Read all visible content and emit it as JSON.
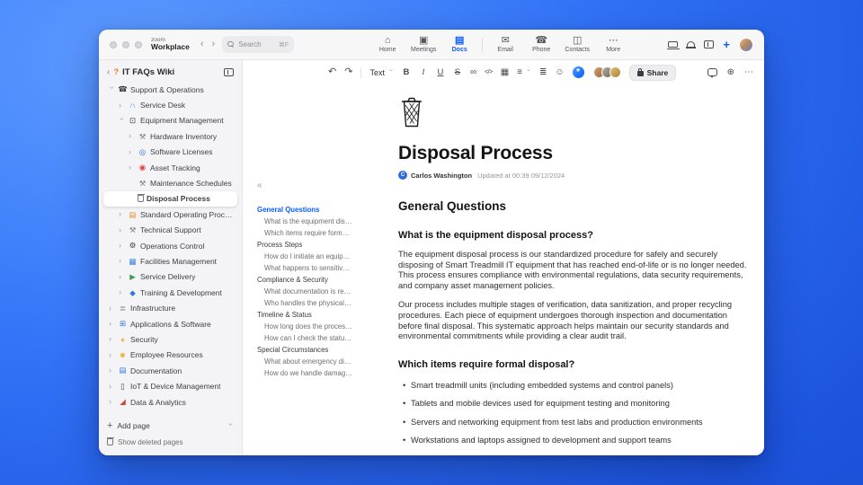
{
  "window": {
    "brand": {
      "top": "zoom",
      "bottom": "Workplace"
    },
    "search": {
      "placeholder": "Search",
      "shortcut": "⌘F"
    },
    "topnav": [
      {
        "label": "Home",
        "icon": "home-icon"
      },
      {
        "label": "Meetings",
        "icon": "meetings-icon"
      },
      {
        "label": "Docs",
        "icon": "docs-icon",
        "active": true
      },
      {
        "divider": true
      },
      {
        "label": "Email",
        "icon": "email-icon"
      },
      {
        "label": "Phone",
        "icon": "phone-icon"
      },
      {
        "label": "Contacts",
        "icon": "contacts-icon"
      },
      {
        "label": "More",
        "icon": "more-icon"
      }
    ],
    "right_icons": [
      "laptop-icon",
      "bell-icon",
      "panel-icon",
      "ai-companion-icon",
      "user-avatar"
    ]
  },
  "sidebar": {
    "emoji": "?",
    "title": "IT FAQs Wiki",
    "items": [
      {
        "label": "Support & Operations",
        "icon": "phone-icon",
        "color": "#3c3c41",
        "indent": 0,
        "chevron": "down"
      },
      {
        "label": "Service Desk",
        "icon": "headset-icon",
        "color": "#2f7bd9",
        "indent": 1,
        "chevron": "right"
      },
      {
        "label": "Equipment Management",
        "icon": "monitor-icon",
        "color": "#3c3c41",
        "indent": 1,
        "chevron": "down"
      },
      {
        "label": "Hardware Inventory",
        "icon": "wrench-icon",
        "color": "#7c7c82",
        "indent": 2,
        "chevron": "right"
      },
      {
        "label": "Software Licenses",
        "icon": "disc-icon",
        "color": "#2f7bd9",
        "indent": 2,
        "chevron": "right"
      },
      {
        "label": "Asset Tracking",
        "icon": "pin-icon",
        "color": "#d8433c",
        "indent": 2,
        "chevron": "right"
      },
      {
        "label": "Maintenance Schedules",
        "icon": "tools-icon",
        "color": "#7c7c82",
        "indent": 2,
        "chevron": null
      },
      {
        "label": "Disposal Process",
        "icon": "trash-icon",
        "color": "#5c5c61",
        "indent": 2,
        "chevron": null,
        "selected": true
      },
      {
        "label": "Standard Operating Procedures",
        "icon": "book-icon",
        "color": "#e58f2a",
        "indent": 1,
        "chevron": "right"
      },
      {
        "label": "Technical Support",
        "icon": "wrench-icon",
        "color": "#7c7c82",
        "indent": 1,
        "chevron": "right"
      },
      {
        "label": "Operations Control",
        "icon": "gear-icon",
        "color": "#3c3c41",
        "indent": 1,
        "chevron": "right"
      },
      {
        "label": "Facilities Management",
        "icon": "building-icon",
        "color": "#2f7bd9",
        "indent": 1,
        "chevron": "right"
      },
      {
        "label": "Service Delivery",
        "icon": "truck-icon",
        "color": "#3f9d58",
        "indent": 1,
        "chevron": "right"
      },
      {
        "label": "Training & Development",
        "icon": "graduation-icon",
        "color": "#2f7bd9",
        "indent": 1,
        "chevron": "right"
      },
      {
        "label": "Infrastructure",
        "icon": "server-icon",
        "color": "#7c7c82",
        "indent": 0,
        "chevron": "right"
      },
      {
        "label": "Applications & Software",
        "icon": "grid-icon",
        "color": "#2f7bd9",
        "indent": 0,
        "chevron": "right"
      },
      {
        "label": "Security",
        "icon": "shield-icon",
        "color": "#e5b93c",
        "indent": 0,
        "chevron": "right"
      },
      {
        "label": "Employee Resources",
        "icon": "people-icon",
        "color": "#e5b93c",
        "indent": 0,
        "chevron": "right"
      },
      {
        "label": "Documentation",
        "icon": "docs-icon",
        "color": "#2f7bd9",
        "indent": 0,
        "chevron": "right"
      },
      {
        "label": "IoT & Device Management",
        "icon": "device-icon",
        "color": "#3c3c41",
        "indent": 0,
        "chevron": "right"
      },
      {
        "label": "Data & Analytics",
        "icon": "chart-icon",
        "color": "#d8433c",
        "indent": 0,
        "chevron": "right"
      }
    ],
    "add_page": {
      "icon": "plus-icon",
      "label": "Add page",
      "chevron": "chevron-down-icon"
    },
    "deleted": {
      "icon": "trash-icon",
      "label": "Show deleted pages"
    }
  },
  "editor_toolbar": {
    "history_icons": [
      "undo-icon",
      "redo-icon"
    ],
    "text_style": {
      "label": "Text"
    },
    "format_buttons": [
      {
        "label": "B",
        "name": "bold-button"
      },
      {
        "label": "I",
        "name": "italic-button"
      },
      {
        "label": "U",
        "name": "underline-button"
      },
      {
        "label": "S",
        "name": "strikethrough-button"
      }
    ],
    "insert_icons": [
      "link-icon",
      "code-icon",
      "codeblock-icon"
    ],
    "align_icon": "align-icon",
    "extra_icons": [
      "list-icon",
      "emoji-icon"
    ],
    "ai_button": "ai-companion-button",
    "collaborator_avatars": 3,
    "share": {
      "icon": "lock-icon",
      "label": "Share"
    },
    "right_icons": [
      "comment-icon",
      "globe-icon",
      "more-icon"
    ]
  },
  "document": {
    "title": "Disposal Process",
    "author": "Carlos Washington",
    "updated": "Updated at 00:39 09/12/2024",
    "toc": {
      "items": [
        {
          "label": "General Questions",
          "level": 0,
          "active": true
        },
        {
          "label": "What is the equipment disp...",
          "level": 1
        },
        {
          "label": "Which items require formal ...",
          "level": 1
        },
        {
          "label": "Process Steps",
          "level": 0
        },
        {
          "label": "How do I initiate an equipm...",
          "level": 1
        },
        {
          "label": "What happens to sensitive ...",
          "level": 1
        },
        {
          "label": "Compliance & Security",
          "level": 0
        },
        {
          "label": "What documentation is req...",
          "level": 1
        },
        {
          "label": "Who handles the physical di...",
          "level": 1
        },
        {
          "label": "Timeline & Status",
          "level": 0
        },
        {
          "label": "How long does the process ...",
          "level": 1
        },
        {
          "label": "How can I check the status ...",
          "level": 1
        },
        {
          "label": "Special Circumstances",
          "level": 0
        },
        {
          "label": "What about emergency dis...",
          "level": 1
        },
        {
          "label": "How do we handle damage...",
          "level": 1
        }
      ]
    },
    "blocks": [
      {
        "type": "h2",
        "text": "General Questions"
      },
      {
        "type": "h3",
        "text": "What is the equipment disposal process?"
      },
      {
        "type": "p",
        "text": "The equipment disposal process is our standardized procedure for safely and securely disposing of Smart Treadmill IT equipment that has reached end-of-life or is no longer needed. This process ensures compliance with environmental regulations, data security requirements, and company asset management policies."
      },
      {
        "type": "p",
        "text": "Our process includes multiple stages of verification, data sanitization, and proper recycling procedures. Each piece of equipment undergoes thorough inspection and documentation before final disposal. This systematic approach helps maintain our security standards and environmental commitments while providing a clear audit trail."
      },
      {
        "type": "h3",
        "text": "Which items require formal disposal?"
      },
      {
        "type": "ul",
        "items": [
          "Smart treadmill units (including embedded systems and control panels)",
          "Tablets and mobile devices used for equipment testing and monitoring",
          "Servers and networking equipment from test labs and production environments",
          "Workstations and laptops assigned to development and support teams"
        ]
      }
    ]
  }
}
